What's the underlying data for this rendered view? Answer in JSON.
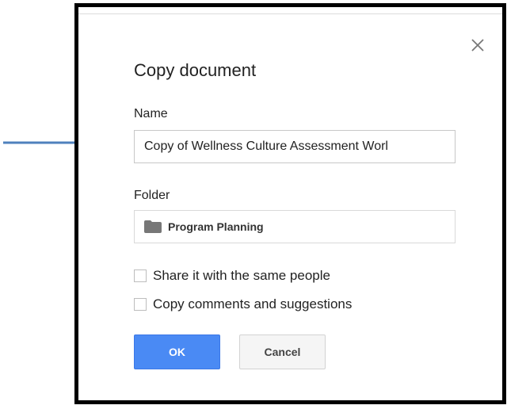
{
  "dialog": {
    "title": "Copy document",
    "name_label": "Name",
    "name_value": "Copy of Wellness Culture Assessment Worl",
    "folder_label": "Folder",
    "folder_name": "Program Planning",
    "options": [
      {
        "label": "Share it with the same people",
        "checked": false
      },
      {
        "label": "Copy comments and suggestions",
        "checked": false
      }
    ],
    "ok_label": "OK",
    "cancel_label": "Cancel"
  },
  "icons": {
    "close": "close-icon",
    "folder": "folder-icon",
    "annotation_arrow": "arrow-icon"
  },
  "colors": {
    "primary_button": "#4a8af4",
    "arrow": "#4f81bd",
    "frame_border": "#000000",
    "folder_icon": "#777777"
  }
}
